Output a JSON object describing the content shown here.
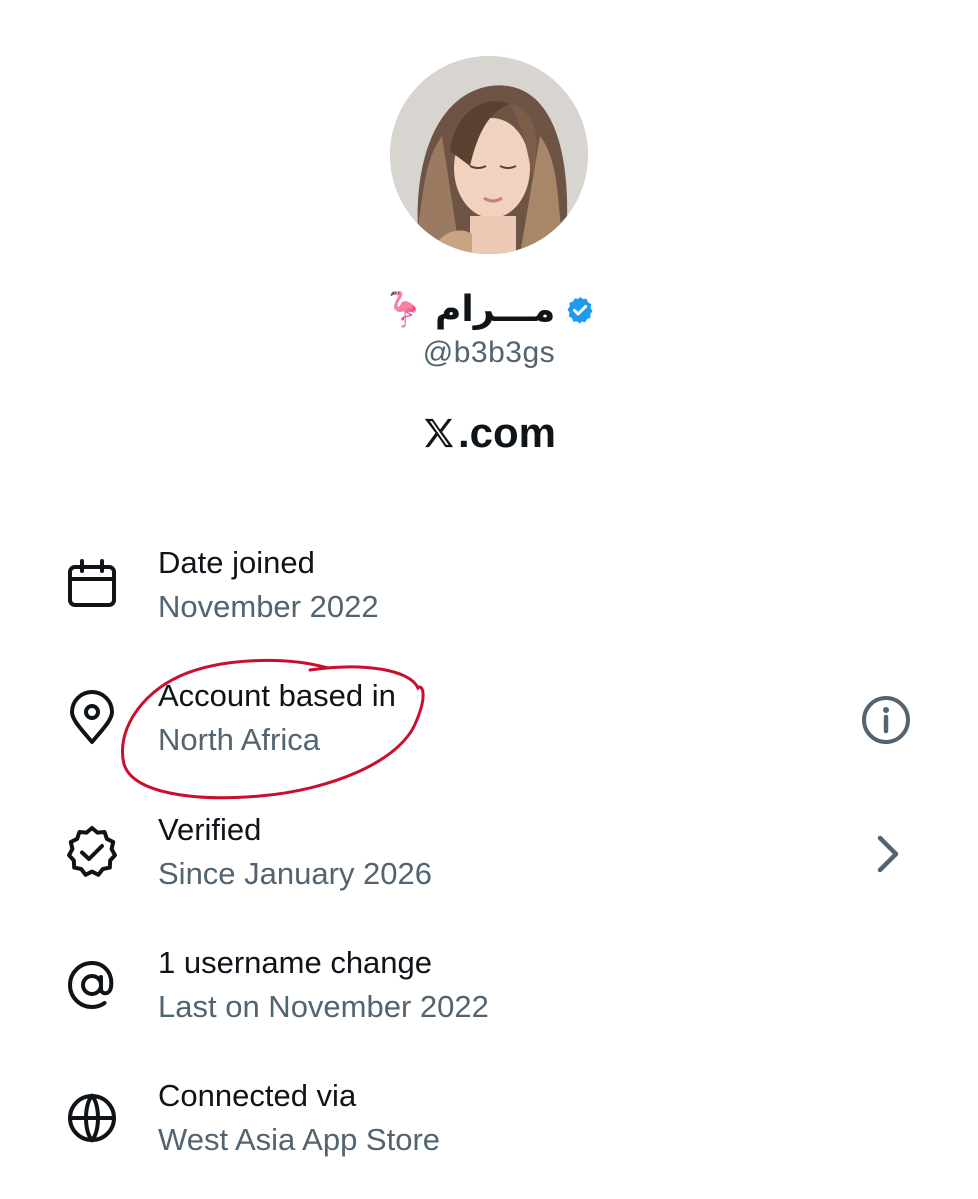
{
  "profile": {
    "display_name": "مـــرام",
    "name_emoji": "🦩",
    "handle": "@b3b3gs",
    "verified_badge_color": "#1d9bf0"
  },
  "brand": {
    "text": ".com",
    "icon": "x-logo-icon"
  },
  "about": {
    "items": [
      {
        "icon": "calendar-icon",
        "title": "Date joined",
        "value": "November 2022"
      },
      {
        "icon": "location-pin-icon",
        "title": "Account based in",
        "value": "North Africa",
        "action_icon": "info-icon"
      },
      {
        "icon": "verified-badge-outline-icon",
        "title": "Verified",
        "value": "Since January 2026",
        "action_icon": "chevron-right-icon"
      },
      {
        "icon": "at-sign-icon",
        "title": "1 username change",
        "value": "Last on November 2022"
      },
      {
        "icon": "globe-icon",
        "title": "Connected via",
        "value": "West Asia App Store"
      }
    ]
  },
  "annotation": {
    "color": "#c8102e",
    "target": "Account based in"
  }
}
